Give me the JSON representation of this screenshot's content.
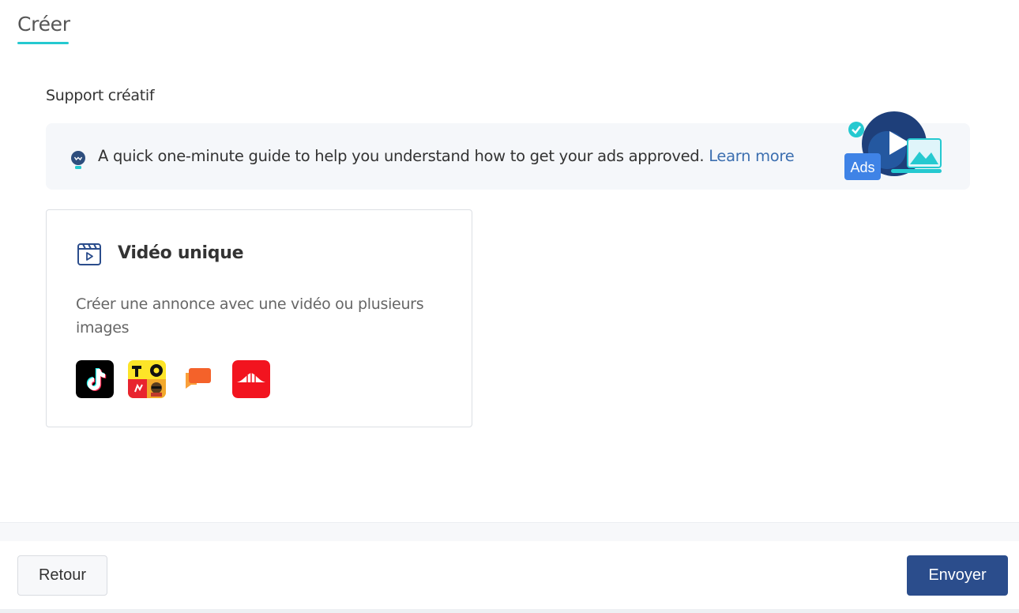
{
  "header": {
    "tab_title": "Créer"
  },
  "creative": {
    "section_label": "Support créatif",
    "guide": {
      "text": "A quick one-minute guide to help you understand how to get your ads approved.",
      "link_label": "Learn more",
      "illustration_label": "Ads"
    }
  },
  "option_card": {
    "title": "Vidéo unique",
    "description": "Créer une annonce avec une vidéo ou plusieurs images",
    "platforms": [
      {
        "name": "tiktok-icon",
        "color": "#000000"
      },
      {
        "name": "topbuzz-icon",
        "color": "#fde428"
      },
      {
        "name": "babe-icon",
        "color": "#f77c1f"
      },
      {
        "name": "vigo-icon",
        "color": "#f2141f"
      }
    ]
  },
  "footer": {
    "back_label": "Retour",
    "send_label": "Envoyer"
  },
  "colors": {
    "accent": "#25c9d0",
    "primary_button": "#2b4d8c",
    "link": "#3c6fb0"
  }
}
